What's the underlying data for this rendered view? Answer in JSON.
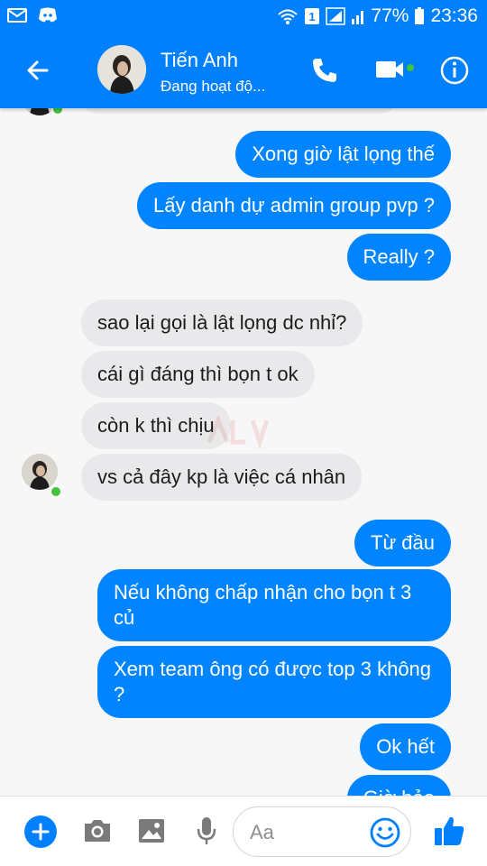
{
  "status_bar": {
    "battery": "77%",
    "time": "23:36",
    "icons": [
      "email-icon",
      "discord-icon",
      "wifi-icon",
      "sim1-icon",
      "signal-icon",
      "signal-icon",
      "battery-icon"
    ]
  },
  "header": {
    "contact_name": "Tiến Anh",
    "contact_status": "Đang hoạt độ..."
  },
  "messages": [
    {
      "side": "out",
      "text": "Xong giờ lật lọng thế"
    },
    {
      "side": "out",
      "text": "Lấy danh dự admin group pvp ?"
    },
    {
      "side": "out",
      "text": "Really ?"
    },
    {
      "side": "in",
      "text": "sao lại gọi là lật lọng dc nhỉ?"
    },
    {
      "side": "in",
      "text": "cái gì đáng thì bọn t ok"
    },
    {
      "side": "in",
      "text": "còn k thì chịu"
    },
    {
      "side": "in",
      "text": "vs cả đây kp là việc cá nhân"
    },
    {
      "side": "out",
      "text": "Từ đầu"
    },
    {
      "side": "out",
      "text": "Nếu không chấp nhận cho bọn t 3 củ"
    },
    {
      "side": "out",
      "text": "Xem team ông có được top 3 không ?"
    },
    {
      "side": "out",
      "text": "Ok hết"
    },
    {
      "side": "out",
      "text": "Giờ bảo"
    }
  ],
  "composer": {
    "placeholder": "Aa",
    "icons": [
      "plus-icon",
      "camera-icon",
      "image-icon",
      "microphone-icon",
      "emoji-icon",
      "thumbs-up-icon"
    ]
  },
  "colors": {
    "brand_blue": "#0180fe",
    "outgoing_bubble": "#0184ff",
    "incoming_bubble": "#e9e9eb",
    "online_green": "#44c33a"
  }
}
